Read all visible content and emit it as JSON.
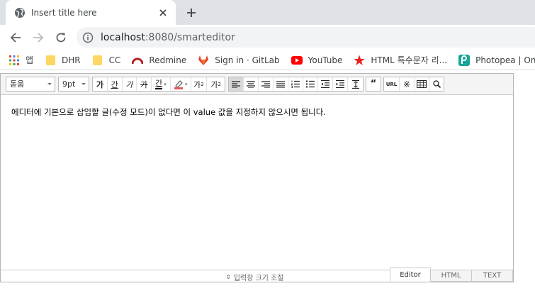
{
  "browser": {
    "tab_title": "Insert title here",
    "url_host": "localhost",
    "url_rest": ":8080/smarteditor",
    "icons": {
      "favicon": "globe-icon",
      "close": "close-icon",
      "new_tab": "plus-icon",
      "back": "back-arrow-icon",
      "forward": "forward-arrow-icon",
      "reload": "reload-icon",
      "info": "info-icon"
    }
  },
  "bookmarks": [
    {
      "label": "앱",
      "icon": "apps-grid-icon"
    },
    {
      "label": "DHR",
      "icon": "folder-icon"
    },
    {
      "label": "CC",
      "icon": "folder-icon"
    },
    {
      "label": "Redmine",
      "icon": "redmine-icon"
    },
    {
      "label": "Sign in · GitLab",
      "icon": "gitlab-icon"
    },
    {
      "label": "YouTube",
      "icon": "youtube-icon"
    },
    {
      "label": "HTML 특수문자 리...",
      "icon": "star-icon"
    },
    {
      "label": "Photopea | Online",
      "icon": "photopea-icon"
    }
  ],
  "editor": {
    "font_family": "돋움",
    "font_size": "9pt",
    "format_buttons": [
      "가",
      "간",
      "가",
      "가",
      "간"
    ],
    "superscript": "가",
    "subscript": "가",
    "url_button": "URL",
    "content": "에디터에 기본으로 삽입할 글(수정 모드)이 없다면 이 value 값을 지정하지 않으시면 됩니다.",
    "resize_label": "입력창 크기 조절",
    "modes": [
      "Editor",
      "HTML",
      "TEXT"
    ],
    "active_mode": "Editor"
  },
  "colors": {
    "tabstrip": "#dee1e6",
    "omnibox": "#f1f3f4",
    "editor_toolbar": "#f4f4f4",
    "gitlab": "#e24329",
    "youtube": "#ff0000",
    "star": "#e8211b",
    "photopea": "#18a497",
    "redmine": "#b32024"
  }
}
